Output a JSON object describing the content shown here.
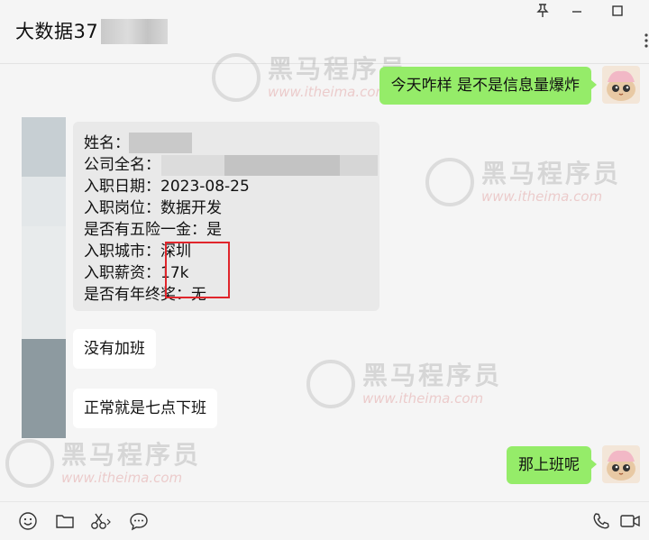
{
  "window": {
    "title": "大数据37",
    "pin_icon": "pin-icon",
    "minimize_icon": "minimize-icon",
    "maximize_icon": "maximize-icon",
    "more_icon": "more-icon"
  },
  "watermark": {
    "brand_cn": "黑马程序员",
    "brand_url": "www.itheima.com"
  },
  "messages": {
    "first_sent": "今天咋样 是不是信息量爆炸",
    "info_card": {
      "lines": [
        "姓名：",
        "公司全名：",
        "入职日期：2023-08-25",
        "入职岗位：数据开发",
        "是否有五险一金：是",
        "入职城市：深圳",
        "入职薪资：17k",
        "是否有年终奖：无"
      ]
    },
    "no_overtime": "没有加班",
    "normal_off": "正常就是七点下班",
    "last_sent": "那上班呢"
  },
  "toolbar": {
    "icons": [
      "emoji-icon",
      "folder-icon",
      "scissors-icon",
      "chat-history-icon",
      "phone-icon",
      "video-icon"
    ]
  },
  "colors": {
    "sent_bubble": "#95ec69",
    "received_bubble": "#ffffff",
    "card_bubble": "#e9e9e9",
    "highlight_box": "#e0252b",
    "background": "#f5f5f5"
  }
}
